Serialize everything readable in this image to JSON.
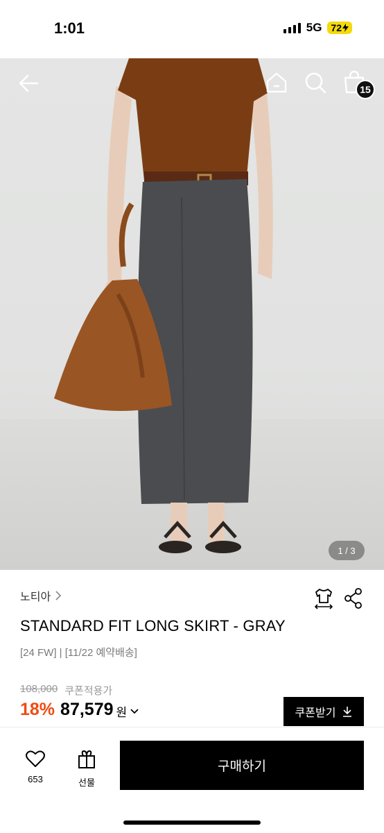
{
  "status": {
    "time": "1:01",
    "network": "5G",
    "battery": "72"
  },
  "icons": {
    "back": "back-arrow-icon",
    "home": "home-icon",
    "search": "search-icon",
    "cart": "shopping-bag-icon",
    "size": "size-guide-icon",
    "share": "share-icon",
    "heart": "heart-icon",
    "gift": "gift-icon"
  },
  "header": {
    "cart_count": "15"
  },
  "gallery": {
    "indicator": "1 / 3"
  },
  "product": {
    "brand": "노티아",
    "name": "STANDARD FIT LONG SKIRT - GRAY",
    "sub": "[24 FW] | [11/22 예약배송]",
    "original_price": "108,000",
    "coupon_price_label": "쿠폰적용가",
    "discount": "18%",
    "final_price": "87,579",
    "currency": "원",
    "coupon_button": "쿠폰받기"
  },
  "bottom": {
    "like_count": "653",
    "gift_label": "선물",
    "buy_label": "구매하기"
  },
  "colors": {
    "discount": "#ee4c11",
    "primary": "#000000"
  }
}
